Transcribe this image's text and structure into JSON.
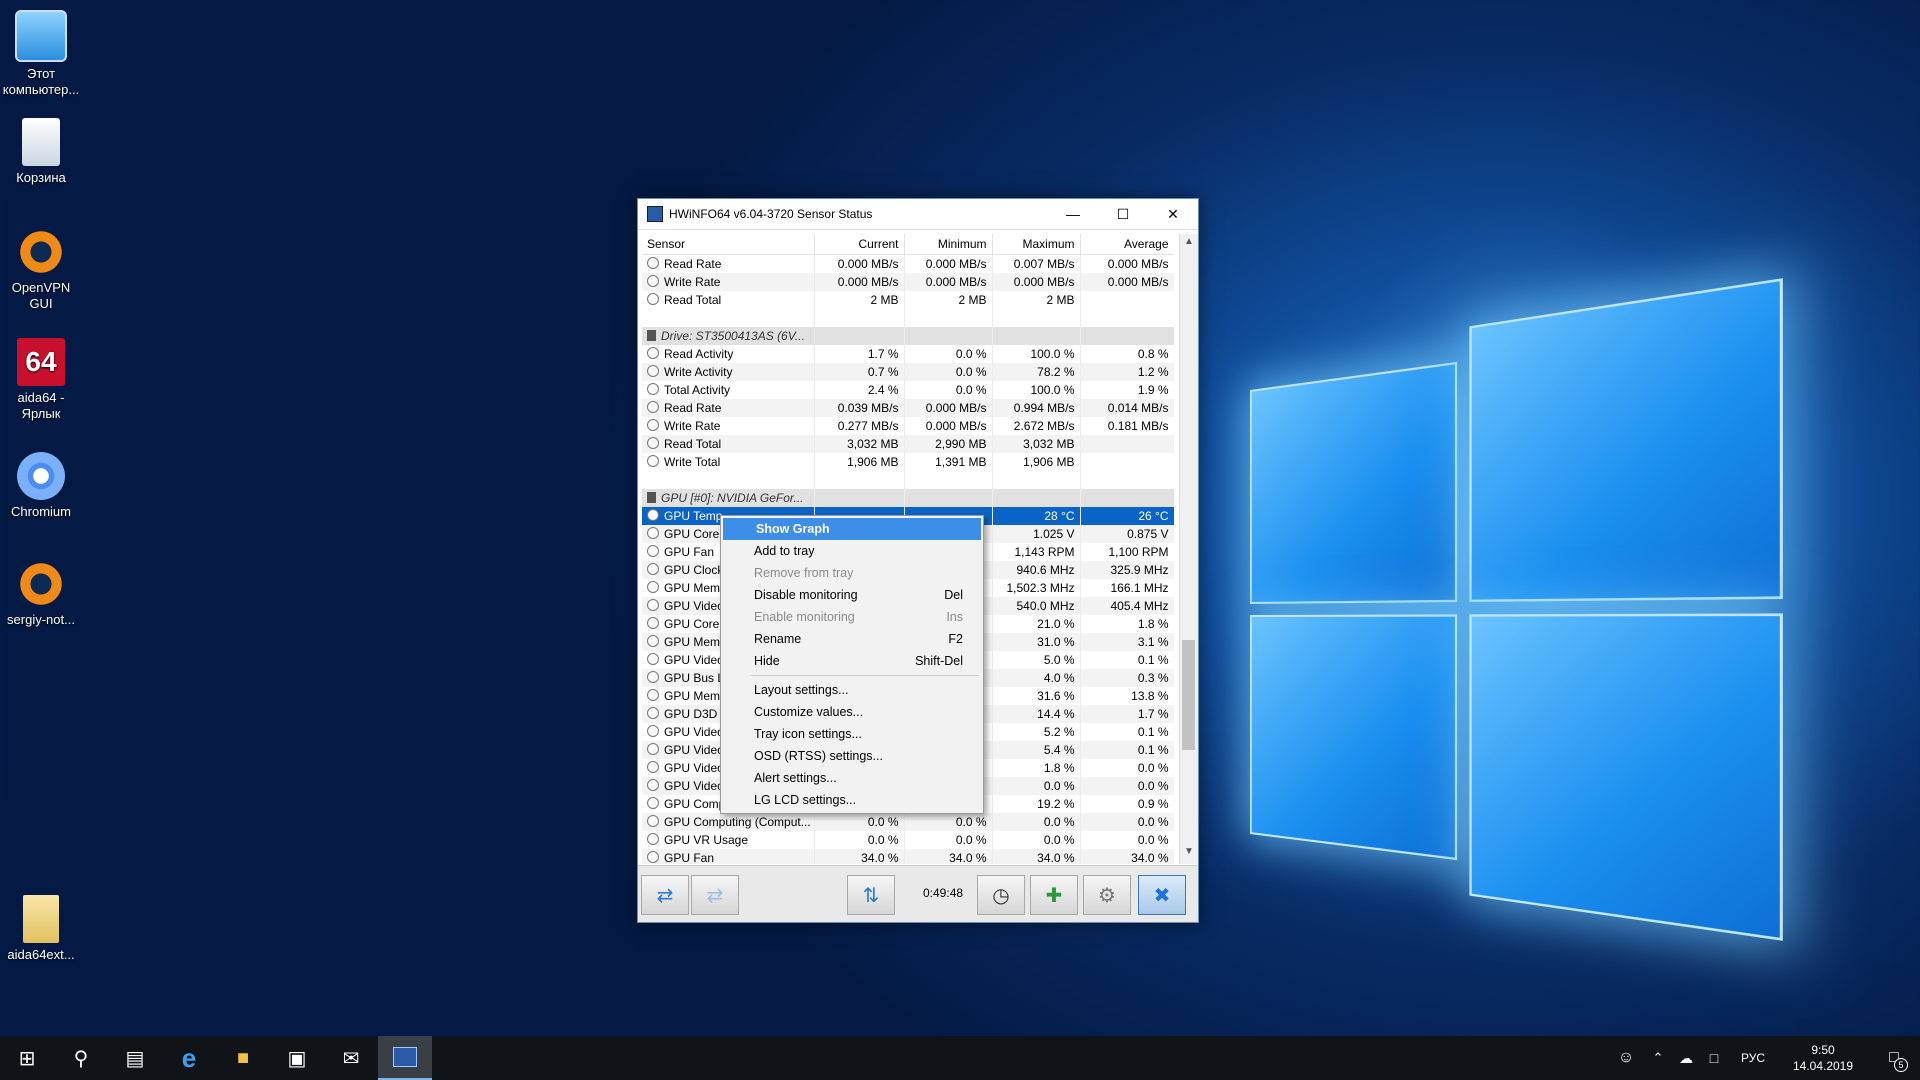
{
  "desktop": {
    "icons": [
      {
        "label": "Этот компьютер...",
        "icon": "computer-icon"
      },
      {
        "label": "Корзина",
        "icon": "recycle-bin-icon"
      },
      {
        "label": "OpenVPN GUI",
        "icon": "openvpn-icon"
      },
      {
        "label": "aida64 - Ярлык",
        "icon": "aida64-icon"
      },
      {
        "label": "Chromium",
        "icon": "chromium-icon"
      },
      {
        "label": "sergiy-not...",
        "icon": "openvpn-config-icon"
      },
      {
        "label": "aida64ext...",
        "icon": "archive-icon"
      }
    ]
  },
  "window": {
    "title": "HWiNFO64 v6.04-3720 Sensor Status",
    "columns": [
      "Sensor",
      "Current",
      "Minimum",
      "Maximum",
      "Average"
    ],
    "rows": [
      {
        "type": "row",
        "name": "Read Rate",
        "cur": "0.000 MB/s",
        "min": "0.000 MB/s",
        "max": "0.007 MB/s",
        "avg": "0.000 MB/s"
      },
      {
        "type": "row",
        "name": "Write Rate",
        "cur": "0.000 MB/s",
        "min": "0.000 MB/s",
        "max": "0.000 MB/s",
        "avg": "0.000 MB/s"
      },
      {
        "type": "row",
        "name": "Read Total",
        "cur": "2 MB",
        "min": "2 MB",
        "max": "2 MB",
        "avg": ""
      },
      {
        "type": "blank"
      },
      {
        "type": "group",
        "name": "Drive: ST3500413AS (6V..."
      },
      {
        "type": "row",
        "name": "Read Activity",
        "cur": "1.7 %",
        "min": "0.0 %",
        "max": "100.0 %",
        "avg": "0.8 %"
      },
      {
        "type": "row",
        "name": "Write Activity",
        "cur": "0.7 %",
        "min": "0.0 %",
        "max": "78.2 %",
        "avg": "1.2 %"
      },
      {
        "type": "row",
        "name": "Total Activity",
        "cur": "2.4 %",
        "min": "0.0 %",
        "max": "100.0 %",
        "avg": "1.9 %"
      },
      {
        "type": "row",
        "name": "Read Rate",
        "cur": "0.039 MB/s",
        "min": "0.000 MB/s",
        "max": "0.994 MB/s",
        "avg": "0.014 MB/s"
      },
      {
        "type": "row",
        "name": "Write Rate",
        "cur": "0.277 MB/s",
        "min": "0.000 MB/s",
        "max": "2.672 MB/s",
        "avg": "0.181 MB/s"
      },
      {
        "type": "row",
        "name": "Read Total",
        "cur": "3,032 MB",
        "min": "2,990 MB",
        "max": "3,032 MB",
        "avg": ""
      },
      {
        "type": "row",
        "name": "Write Total",
        "cur": "1,906 MB",
        "min": "1,391 MB",
        "max": "1,906 MB",
        "avg": ""
      },
      {
        "type": "blank"
      },
      {
        "type": "group",
        "name": "GPU [#0]: NVIDIA GeFor..."
      },
      {
        "type": "sel",
        "name": "GPU Temp",
        "cur": "",
        "min": "",
        "max": "28 °C",
        "avg": "26 °C"
      },
      {
        "type": "row",
        "name": "GPU Core V",
        "cur": "",
        "min": "",
        "max": "1.025 V",
        "avg": "0.875 V"
      },
      {
        "type": "row",
        "name": "GPU Fan",
        "cur": "",
        "min": "",
        "max": "1,143 RPM",
        "avg": "1,100 RPM"
      },
      {
        "type": "row",
        "name": "GPU Clock",
        "cur": "",
        "min": "",
        "max": "940.6 MHz",
        "avg": "325.9 MHz"
      },
      {
        "type": "row",
        "name": "GPU Memo",
        "cur": "",
        "min": "",
        "max": "1,502.3 MHz",
        "avg": "166.1 MHz"
      },
      {
        "type": "row",
        "name": "GPU Video",
        "cur": "",
        "min": "",
        "max": "540.0 MHz",
        "avg": "405.4 MHz"
      },
      {
        "type": "row",
        "name": "GPU Core I",
        "cur": "",
        "min": "",
        "max": "21.0 %",
        "avg": "1.8 %"
      },
      {
        "type": "row",
        "name": "GPU Memo",
        "cur": "",
        "min": "",
        "max": "31.0 %",
        "avg": "3.1 %"
      },
      {
        "type": "row",
        "name": "GPU Video",
        "cur": "",
        "min": "",
        "max": "5.0 %",
        "avg": "0.1 %"
      },
      {
        "type": "row",
        "name": "GPU Bus Lo",
        "cur": "",
        "min": "",
        "max": "4.0 %",
        "avg": "0.3 %"
      },
      {
        "type": "row",
        "name": "GPU Memo",
        "cur": "",
        "min": "",
        "max": "31.6 %",
        "avg": "13.8 %"
      },
      {
        "type": "row",
        "name": "GPU D3D U",
        "cur": "",
        "min": "",
        "max": "14.4 %",
        "avg": "1.7 %"
      },
      {
        "type": "row",
        "name": "GPU Video",
        "cur": "",
        "min": "",
        "max": "5.2 %",
        "avg": "0.1 %"
      },
      {
        "type": "row",
        "name": "GPU Video",
        "cur": "",
        "min": "",
        "max": "5.4 %",
        "avg": "0.1 %"
      },
      {
        "type": "row",
        "name": "GPU Video",
        "cur": "",
        "min": "",
        "max": "1.8 %",
        "avg": "0.0 %"
      },
      {
        "type": "row",
        "name": "GPU Video",
        "cur": "",
        "min": "",
        "max": "0.0 %",
        "avg": "0.0 %"
      },
      {
        "type": "row",
        "name": "GPU Comp",
        "cur": "",
        "min": "",
        "max": "19.2 %",
        "avg": "0.9 %"
      },
      {
        "type": "row",
        "name": "GPU Computing (Comput...",
        "cur": "0.0 %",
        "min": "0.0 %",
        "max": "0.0 %",
        "avg": "0.0 %"
      },
      {
        "type": "row",
        "name": "GPU VR Usage",
        "cur": "0.0 %",
        "min": "0.0 %",
        "max": "0.0 %",
        "avg": "0.0 %"
      },
      {
        "type": "row",
        "name": "GPU Fan",
        "cur": "34.0 %",
        "min": "34.0 %",
        "max": "34.0 %",
        "avg": "34.0 %"
      }
    ],
    "timer": "0:49:48"
  },
  "context_menu": {
    "items": [
      {
        "label": "Show Graph",
        "shortcut": "",
        "state": "highlight"
      },
      {
        "label": "Add to tray",
        "shortcut": "",
        "state": "normal"
      },
      {
        "label": "Remove from tray",
        "shortcut": "",
        "state": "disabled"
      },
      {
        "label": "Disable monitoring",
        "shortcut": "Del",
        "state": "normal"
      },
      {
        "label": "Enable monitoring",
        "shortcut": "Ins",
        "state": "disabled"
      },
      {
        "label": "Rename",
        "shortcut": "F2",
        "state": "normal"
      },
      {
        "label": "Hide",
        "shortcut": "Shift-Del",
        "state": "normal"
      },
      {
        "sep": true
      },
      {
        "label": "Layout settings...",
        "shortcut": "",
        "state": "normal"
      },
      {
        "label": "Customize values...",
        "shortcut": "",
        "state": "normal"
      },
      {
        "label": "Tray icon settings...",
        "shortcut": "",
        "state": "normal"
      },
      {
        "label": "OSD (RTSS) settings...",
        "shortcut": "",
        "state": "normal"
      },
      {
        "label": "Alert settings...",
        "shortcut": "",
        "state": "normal"
      },
      {
        "label": "LG LCD settings...",
        "shortcut": "",
        "state": "normal"
      }
    ]
  },
  "taskbar": {
    "lang": "РУС",
    "time": "9:50",
    "date": "14.04.2019",
    "notifications": "5"
  }
}
